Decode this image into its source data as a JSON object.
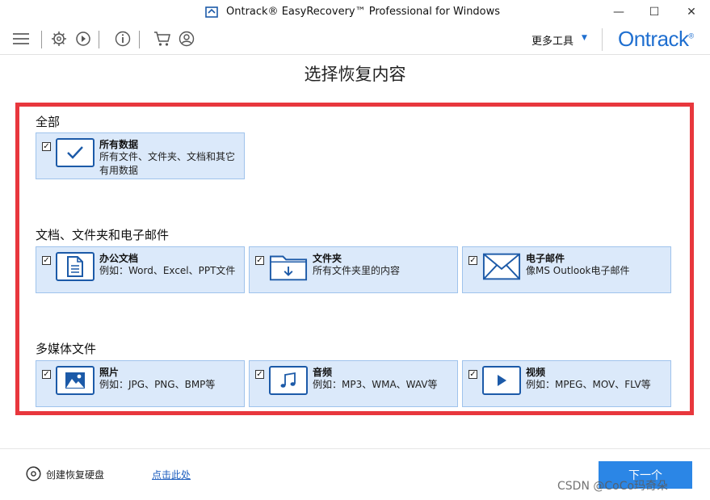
{
  "window": {
    "title": "Ontrack® EasyRecovery™ Professional for Windows",
    "minimize_glyph": "—",
    "maximize_glyph": "☐",
    "close_glyph": "✕"
  },
  "toolbar": {
    "more_tools_label": "更多工具",
    "more_tools_caret": "▼",
    "brand_name": "Ontrack",
    "brand_mark": "®",
    "icons": [
      "menu-icon",
      "gear-icon",
      "history-icon",
      "info-icon",
      "cart-icon",
      "account-icon"
    ]
  },
  "heading": "选择恢复内容",
  "sections": {
    "all": {
      "title": "全部",
      "cards": [
        {
          "title": "所有数据",
          "desc": "所有文件、文件夹、文档和其它有用数据",
          "icon": "checkmark-icon",
          "checked": "✓"
        }
      ]
    },
    "documents": {
      "title": "文档、文件夹和电子邮件",
      "cards": [
        {
          "title": "办公文档",
          "desc": "例如：Word、Excel、PPT文件",
          "icon": "document-icon",
          "checked": "✓"
        },
        {
          "title": "文件夹",
          "desc": "所有文件夹里的内容",
          "icon": "folder-icon",
          "checked": "✓"
        },
        {
          "title": "电子邮件",
          "desc": "像MS Outlook电子邮件",
          "icon": "envelope-icon",
          "checked": "✓"
        }
      ]
    },
    "media": {
      "title": "多媒体文件",
      "cards": [
        {
          "title": "照片",
          "desc": "例如：JPG、PNG、BMP等",
          "icon": "image-icon",
          "checked": "✓"
        },
        {
          "title": "音频",
          "desc": "例如：MP3、WMA、WAV等",
          "icon": "music-icon",
          "checked": "✓"
        },
        {
          "title": "视频",
          "desc": "例如：MPEG、MOV、FLV等",
          "icon": "play-icon",
          "checked": "✓"
        }
      ]
    }
  },
  "footer": {
    "create_disk_label": "创建恢复硬盘",
    "click_here_label": "点击此处",
    "next_label": "下一个",
    "watermark": "CSDN @CoCo玛奇朵"
  },
  "colors": {
    "accent": "#1f6fd0",
    "card_bg": "#dbe9fa",
    "card_border": "#9fc3ec",
    "highlight": "#e8373d",
    "next_button": "#2b86e6"
  }
}
